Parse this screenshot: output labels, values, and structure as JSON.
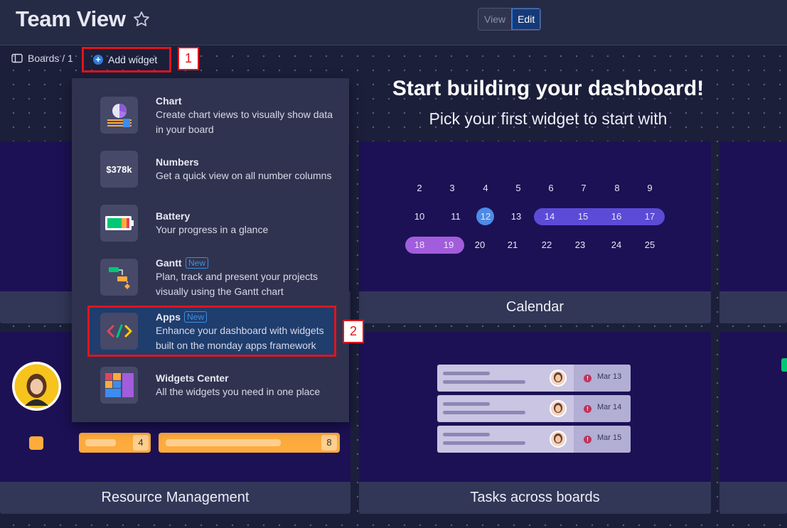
{
  "header": {
    "title": "Team View",
    "view_label": "View",
    "edit_label": "Edit"
  },
  "breadcrumb": {
    "label": "Boards / 1",
    "add_widget_label": "Add widget"
  },
  "markers": {
    "one": "1",
    "two": "2"
  },
  "hero": {
    "title": "Start building your dashboard!",
    "subtitle": "Pick your first widget to start with"
  },
  "menu": {
    "items": [
      {
        "name": "Chart",
        "desc": "Create chart views to visually show data in your board",
        "icon": "chart-icon"
      },
      {
        "name": "Numbers",
        "desc": "Get a quick view on all number columns",
        "icon": "numbers-icon",
        "icon_text": "$378k"
      },
      {
        "name": "Battery",
        "desc": "Your progress in a glance",
        "icon": "battery-icon"
      },
      {
        "name": "Gantt",
        "desc": "Plan, track and present your projects visually using the Gantt chart",
        "icon": "gantt-icon",
        "tag": "New"
      },
      {
        "name": "Apps",
        "desc": "Enhance your dashboard with widgets built on the monday apps framework",
        "icon": "code-icon",
        "tag": "New"
      },
      {
        "name": "Widgets Center",
        "desc": "All the widgets you need in one place",
        "icon": "widgets-center-icon"
      }
    ]
  },
  "calendar": {
    "label": "Calendar",
    "row1": [
      "2",
      "3",
      "4",
      "5",
      "6",
      "7",
      "8",
      "9"
    ],
    "row2": [
      "10",
      "11",
      "12",
      "13",
      "14",
      "15",
      "16",
      "17"
    ],
    "row3": [
      "18",
      "19",
      "20",
      "21",
      "22",
      "23",
      "24",
      "25"
    ]
  },
  "tasks": {
    "label": "Tasks across boards",
    "dates": [
      "Mar 13",
      "Mar 14",
      "Mar 15"
    ]
  },
  "resource": {
    "label": "Resource Management",
    "counts": [
      "4",
      "8"
    ]
  },
  "colors": {
    "accent_blue": "#2f7bd6",
    "highlight_red": "#e0141d",
    "card_bg": "#1c1155",
    "calendar_purple": "#5b4bd6",
    "calendar_violet": "#a25ddc",
    "orange": "#fdab3d"
  }
}
